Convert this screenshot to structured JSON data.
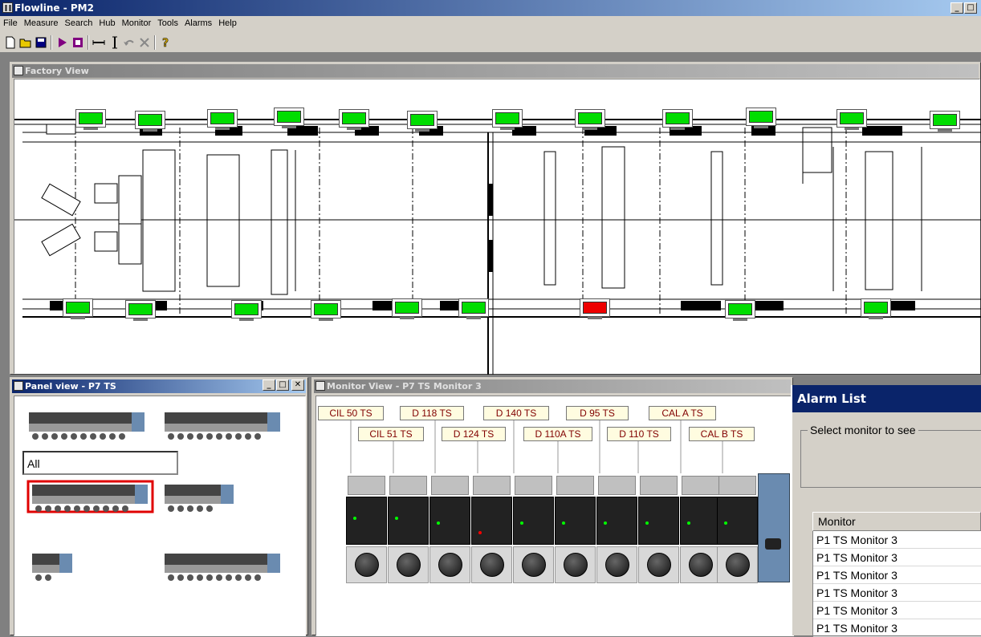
{
  "window": {
    "title": "Flowline - PM2",
    "min": "_",
    "max": "□",
    "close": "✕"
  },
  "menu": [
    "File",
    "Measure",
    "Search",
    "Hub",
    "Monitor",
    "Tools",
    "Alarms",
    "Help"
  ],
  "toolbar": {
    "icons": [
      "new-icon",
      "open-icon",
      "save-icon",
      "play-icon",
      "stop-icon",
      "horizontal-line-icon",
      "vertical-line-icon",
      "undo-icon",
      "delete-icon",
      "help-icon"
    ]
  },
  "factory_view": {
    "title": "Factory View"
  },
  "panel_view": {
    "title": "Panel view - P7 TS",
    "min": "_",
    "max": "□",
    "close": "✕"
  },
  "monitor_view": {
    "title": "Monitor View - P7 TS Monitor 3",
    "tags_top": [
      "CIL 50 TS",
      "D 118 TS",
      "D 140 TS",
      "D 95 TS",
      "CAL A TS"
    ],
    "tags_bottom": [
      "CIL 51 TS",
      "D 124 TS",
      "D 110A TS",
      "D 110 TS",
      "CAL B TS"
    ]
  },
  "alarm_list": {
    "title": "Alarm List",
    "group_label": "Select monitor to see",
    "selected_monitor": "All",
    "column_header": "Monitor",
    "rows": [
      "P1 TS Monitor 3",
      "P1 TS Monitor 3",
      "P1 TS Monitor 3",
      "P1 TS Monitor 3",
      "P1 TS Monitor 3",
      "P1 TS Monitor 3"
    ]
  },
  "colors": {
    "ok": "#00dd00",
    "alarm": "#ee0000",
    "title_active": "#0a246a"
  }
}
